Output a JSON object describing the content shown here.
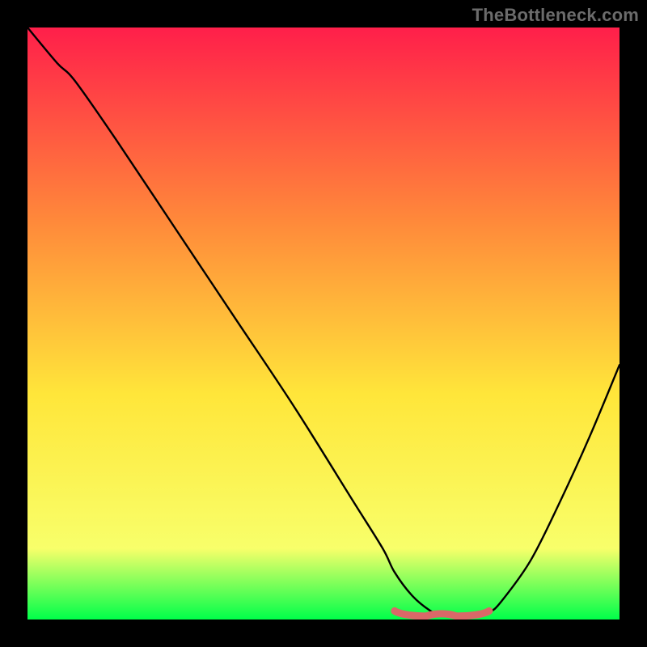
{
  "watermark": "TheBottleneck.com",
  "chart_data": {
    "type": "line",
    "title": "",
    "xlabel": "",
    "ylabel": "",
    "xlim": [
      0,
      100
    ],
    "ylim": [
      0,
      100
    ],
    "grid": false,
    "legend": false,
    "background_gradient": {
      "top": "#ff1f4a",
      "mid_top": "#ff8a3a",
      "mid": "#ffe63a",
      "mid_bottom": "#f8ff6a",
      "bottom": "#00ff4a"
    },
    "series": [
      {
        "name": "curve",
        "color": "#000000",
        "x": [
          0,
          5,
          8,
          15,
          25,
          35,
          45,
          55,
          60,
          62,
          65,
          68,
          70,
          72,
          74,
          76,
          78,
          80,
          85,
          90,
          95,
          100
        ],
        "y": [
          100,
          94,
          91,
          81,
          66,
          51,
          36,
          20,
          12,
          8,
          4,
          1.5,
          0.7,
          0.5,
          0.5,
          0.6,
          1.2,
          3,
          10,
          20,
          31,
          43
        ]
      },
      {
        "name": "flat-marker",
        "color": "#e06a6a",
        "x": [
          62,
          78
        ],
        "y": [
          0.9,
          0.9
        ]
      }
    ],
    "flat_region": {
      "x_start": 62,
      "x_end": 78,
      "y": 0.9
    }
  }
}
